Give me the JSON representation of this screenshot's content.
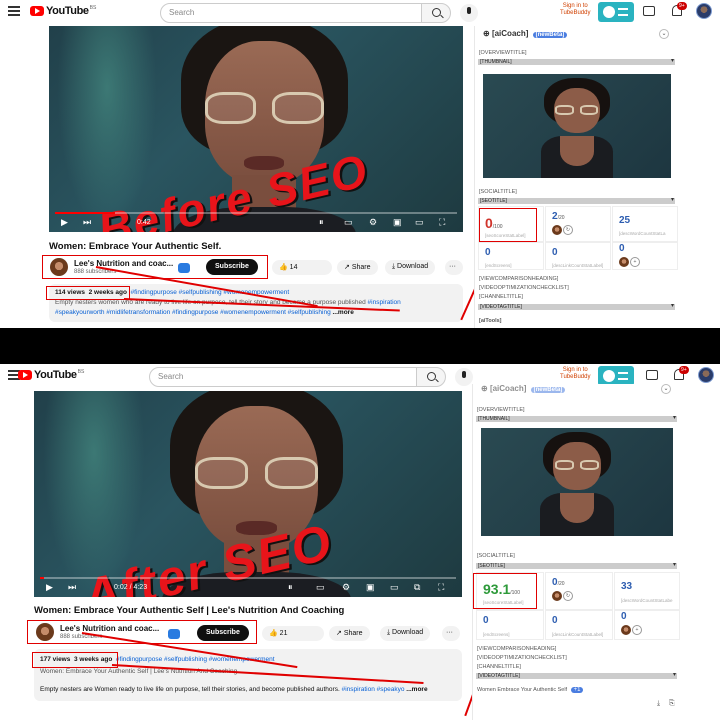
{
  "header": {
    "logo_text": "YouTube",
    "logo_country": "BS",
    "search_placeholder": "Search",
    "sign_in_line1": "Sign in to",
    "sign_in_line2": "TubeBuddy",
    "notif_count_top": "9+",
    "notif_count_bottom": "9+"
  },
  "before": {
    "overlay": "Before SEO",
    "time": "0:42",
    "title": "Women: Embrace Your Authentic Self.",
    "channel_name": "Lee's Nutrition and coac...",
    "subscribers": "888 subscribers",
    "subscribe_label": "Subscribe",
    "likes": "14",
    "share_label": "Share",
    "download_label": "Download",
    "views": "114 views",
    "age": "2 weeks ago",
    "hashtags_line1": "#findingpurpose #selfpublishing #womenempowerment",
    "desc_line1": "Empty nesters women who are ready to live life on purpose, tell their story and become a purpose published",
    "desc_line1_tag": "#inspiration",
    "desc_line2": "#speakyourworth #midlifetransformation #findingpurpose #womenempowerment #selfpublishing",
    "more_label": "...more"
  },
  "after": {
    "overlay": "After SEO",
    "time": "0:02 / 4:23",
    "title": "Women: Embrace Your Authentic Self | Lee's Nutrition And Coaching",
    "channel_name": "Lee's Nutrition and coac...",
    "subscribers": "888 subscribers",
    "subscribe_label": "Subscribe",
    "likes": "21",
    "share_label": "Share",
    "download_label": "Download",
    "views": "177 views",
    "age": "3 weeks ago",
    "hashtags_line1": "#findingpurpose #selfpublishing #womenempowerment",
    "desc_line1": "Women: Embrace Your Authentic Self | Lee's Nutrition And Coaching",
    "desc_line2": "Empty nesters are Women ready to live life on purpose, tell their stories, and become published authors.",
    "desc_line2_tags": "#inspiration #speakyo",
    "more_label": "...more"
  },
  "aicoach": {
    "title": "[aiCoach]",
    "beta": "[newBeta]",
    "labels": {
      "overview": "[OVERVIEWTITLE]",
      "thumbnail": "[THUMBNAIL]",
      "social": "[SOCIALTITLE]",
      "seo": "[SEOTITLE]",
      "viewcomparison": "[VIEWCOMPARISONHEADING]",
      "optimization": "[VIDEOOPTIMIZATIONCHECKLIST]",
      "channel": "[CHANNELTITLE]",
      "videotag": "[VIDEOTAGTITLE]",
      "aitools": "[aiTools]"
    },
    "before": {
      "seo_score": "0",
      "seo_of": "/100",
      "seo_label": "[seoScoreStatLabel]",
      "stat2": "2",
      "stat2_of": "/20",
      "stat3": "25",
      "stat3_label": "[descWordCountStatLa",
      "stat4": "0",
      "stat4_label": "[endScreens]",
      "stat5": "0",
      "stat5_label": "[descLinkCountStatLabel]",
      "stat6": "0"
    },
    "after": {
      "seo_score": "93.1",
      "seo_of": "/100",
      "seo_label": "[seoScoreStatLabel]",
      "stat2": "0",
      "stat2_of": "/20",
      "stat3": "33",
      "stat3_label": "[descWordCountStatLabe",
      "stat4": "0",
      "stat4_label": "[endScreens]",
      "stat5": "0",
      "stat5_label": "[descLinkCountStatLabel]",
      "stat6": "0",
      "footer_title": "Women Embrace Your Authentic Self",
      "footer_badge": "+1"
    }
  },
  "colors": {
    "brand_red": "#ff0000",
    "annotation_red": "#e00000",
    "tubebuddy": "#2ab3c0",
    "score_red": "#d0342c",
    "score_green": "#2e9a3a"
  }
}
